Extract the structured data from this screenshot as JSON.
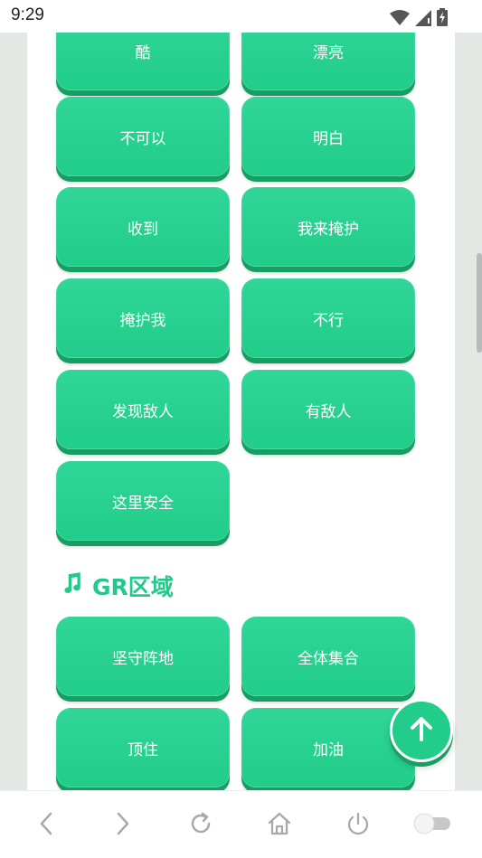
{
  "status_bar": {
    "time": "9:29",
    "icons": [
      "wifi-icon",
      "cell-signal-icon",
      "battery-charging-icon"
    ]
  },
  "buttons": [
    {
      "label": "酷"
    },
    {
      "label": "漂亮"
    },
    {
      "label": "不可以"
    },
    {
      "label": "明白"
    },
    {
      "label": "收到"
    },
    {
      "label": "我来掩护"
    },
    {
      "label": "掩护我"
    },
    {
      "label": "不行"
    },
    {
      "label": "发现敌人"
    },
    {
      "label": "有敌人"
    },
    {
      "label": "这里安全"
    }
  ],
  "section": {
    "title": "GR区域",
    "icon": "music-note-icon",
    "buttons": [
      {
        "label": "坚守阵地"
      },
      {
        "label": "全体集合"
      },
      {
        "label": "顶住"
      },
      {
        "label": "加油"
      }
    ]
  },
  "fab": {
    "icon": "arrow-up-icon"
  },
  "nav_bar": {
    "icons": [
      "back-icon",
      "forward-icon",
      "refresh-icon",
      "home-icon",
      "power-icon",
      "toggle-icon"
    ]
  },
  "colors": {
    "accent": "#22cc8a",
    "accent_dark": "#169e63"
  }
}
